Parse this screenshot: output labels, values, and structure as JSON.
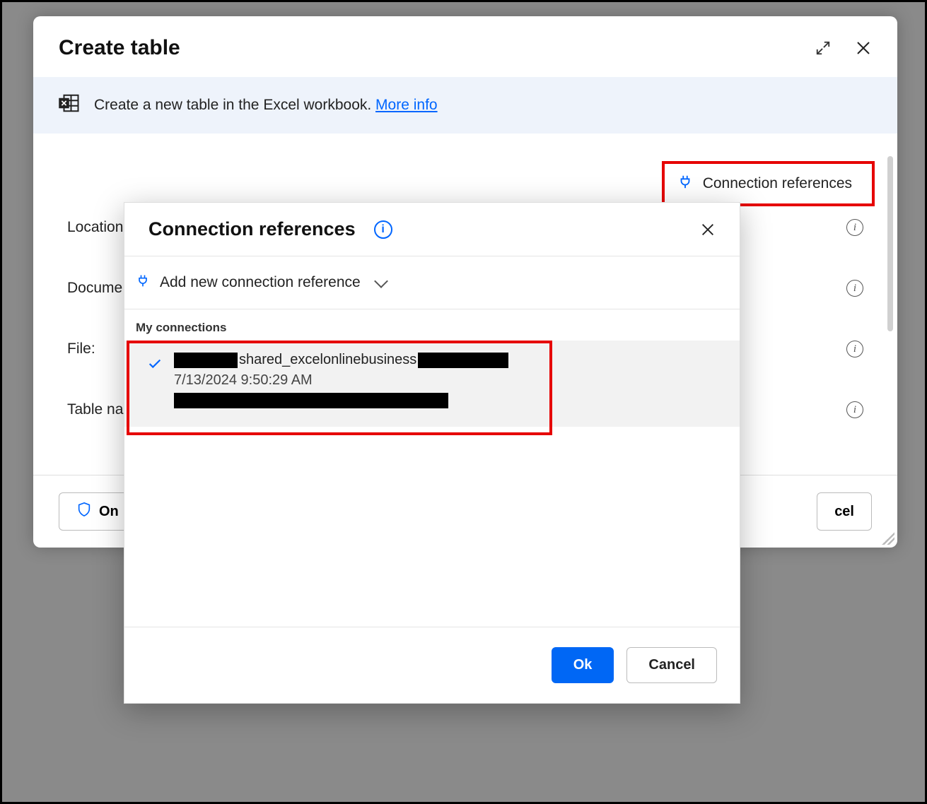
{
  "main": {
    "title": "Create table",
    "banner_text": "Create a new table in the Excel workbook. ",
    "banner_link": "More info",
    "connection_references_label": "Connection references",
    "fields": {
      "location": "Location",
      "document": "Docume",
      "file": "File:",
      "table_name": "Table na"
    },
    "footer": {
      "on_label": "On",
      "cancel_fragment": "cel"
    }
  },
  "popup": {
    "title": "Connection references",
    "add_label": "Add new connection reference",
    "section_label": "My connections",
    "selected_connection": {
      "name_visible": "shared_excelonlinebusiness",
      "date": "7/13/2024 9:50:29 AM"
    },
    "ok_label": "Ok",
    "cancel_label": "Cancel"
  }
}
